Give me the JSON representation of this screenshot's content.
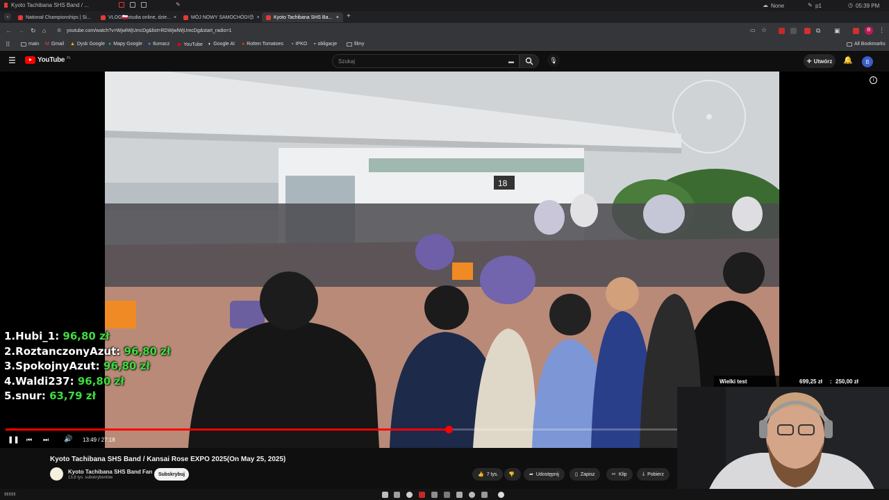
{
  "window": {
    "title": "Kyoto Tachibana SHS Band / ..."
  },
  "systray": {
    "weather": "None",
    "label_p1": "p1",
    "clock": "05:39 PM"
  },
  "tabs": [
    {
      "label": "National Championships | Si..."
    },
    {
      "label": "VLOG🇵🇱studia online, dzie..."
    },
    {
      "label": "MÓJ NOWY SAMOCHÓD!😊"
    },
    {
      "label": "Kyoto Tachibana SHS Ba..."
    }
  ],
  "address": {
    "url": "youtube.com/watch?v=WjwlWjUmcDg&list=RDWjwlWjUmcDg&start_radio=1"
  },
  "profile_letter": "B",
  "bookmarks": [
    "main",
    "Gmail",
    "Dysk Google",
    "Mapy Google",
    "tlumacz",
    "YouTube",
    "Google AI",
    "Rotten Tomatoes",
    "IPKO",
    "obligacje",
    "filmy"
  ],
  "bookmarks_all": "All Bookmarks",
  "youtube": {
    "logo": "YouTube",
    "logo_region": "PL",
    "search_placeholder": "Szukaj",
    "create_label": "Utwórz",
    "avatar_letter": "B"
  },
  "donors": [
    {
      "rank": "1.",
      "name": "Hubi_1:",
      "amount": "96,80 zł"
    },
    {
      "rank": "2.",
      "name": "RoztanczonyAzut:",
      "amount": "96,80 zł"
    },
    {
      "rank": "3.",
      "name": "SpokojnyAzut:",
      "amount": "96,80 zł"
    },
    {
      "rank": "4.",
      "name": "Waldi237:",
      "amount": "96,80 zł"
    },
    {
      "rank": "5.",
      "name": "snur:",
      "amount": "63,79 zł"
    }
  ],
  "video_scene": {
    "gate_number": "18"
  },
  "player": {
    "time": "13:49 / 27:18",
    "progress": 0.505
  },
  "video": {
    "title": "Kyoto Tachibana SHS Band / Kansai Rose EXPO 2025(On May 25, 2025)",
    "channel": "Kyoto Tachibana SHS Band Fan",
    "subscribers": "13,8 tys. subskrybentów",
    "subscribe_label": "Subskrybuj",
    "likes": "7 tys.",
    "share": "Udostępnij",
    "save": "Zapisz",
    "clip": "Klip",
    "download": "Pobierz"
  },
  "goal": {
    "label": "Wielki test",
    "value": "699,25 zł",
    "target": "250,00 zł"
  },
  "colors": {
    "youtube_red": "#ff0000",
    "donation_green": "#3ddc3d",
    "accent_blue": "#3a5ecb"
  }
}
